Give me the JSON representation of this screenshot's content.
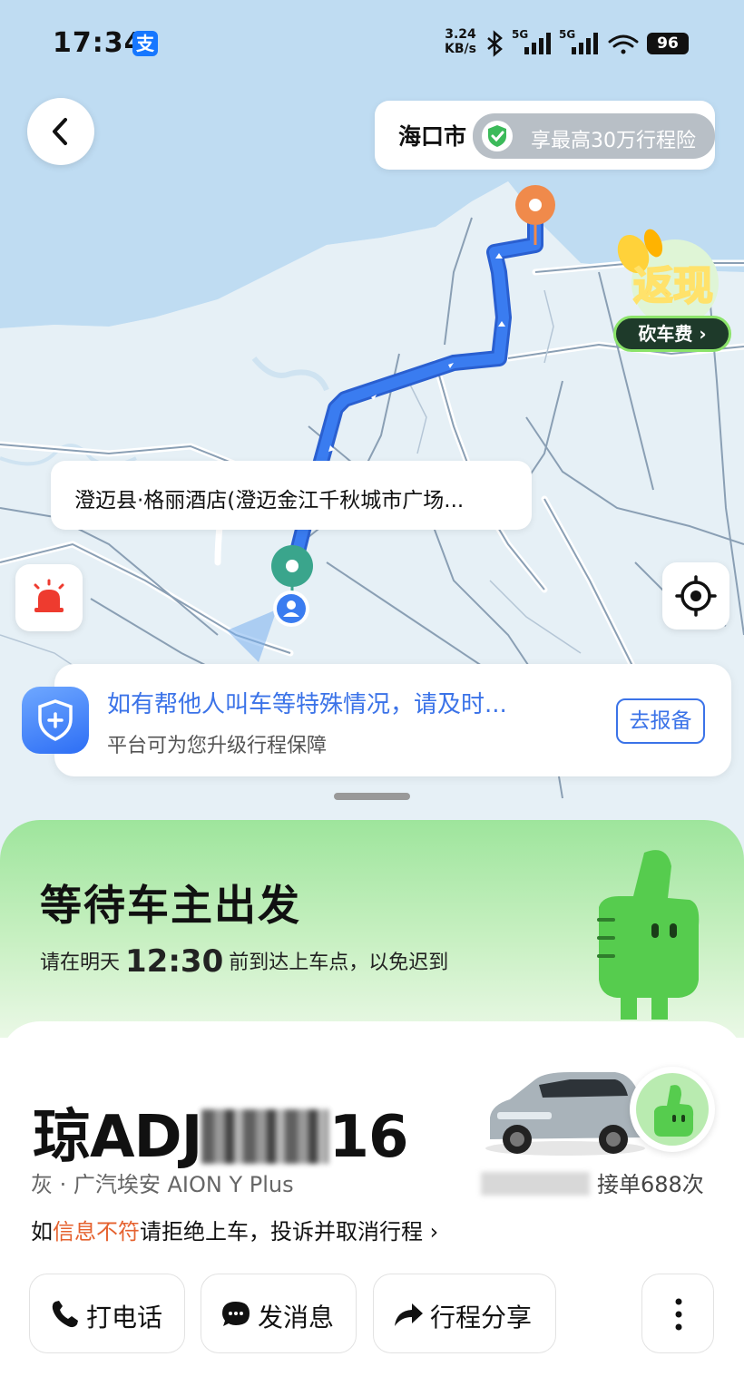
{
  "status_bar": {
    "time": "17:34",
    "alipay_glyph": "支",
    "speed_value": "3.24",
    "speed_unit": "KB/s",
    "net1": "5G",
    "net2": "5G",
    "battery": "96"
  },
  "map": {
    "city": "海口市",
    "insurance_text": "享最高30万行程险",
    "cashback_title": "返现",
    "cashback_sub": "砍车费 ›",
    "pickup_label": "澄迈县·格丽酒店(澄迈金江千秋城市广场...",
    "notice_title": "如有帮他人叫车等特殊情况，请及时...",
    "notice_sub": "平台可为您升级行程保障",
    "notice_button": "去报备"
  },
  "status_card": {
    "title": "等待车主出发",
    "line_prefix": "请在明天",
    "pickup_time": "12:30",
    "line_suffix": "前到达上车点，以免迟到"
  },
  "driver": {
    "plate_prefix": "琼ADJ",
    "plate_suffix": "16",
    "car_info": "灰 · 广汽埃安 AION Y Plus",
    "orders": "接单688次",
    "warn_prefix": "如",
    "warn_highlight": "信息不符",
    "warn_suffix": "请拒绝上车，投诉并取消行程 ›"
  },
  "actions": {
    "call": "打电话",
    "message": "发消息",
    "share": "行程分享",
    "more": "⋮"
  },
  "colors": {
    "route": "#3a7cf0",
    "accent_blue": "#3b73e8",
    "highlight_orange": "#e5622f",
    "status_green": "#9ee59c",
    "pickup_pin": "#3aa58c",
    "dest_pin": "#f08a4b"
  },
  "icons": [
    "back-icon",
    "shield-check-icon",
    "sos-alarm-icon",
    "locate-icon",
    "shield-plus-icon",
    "phone-icon",
    "chat-icon",
    "share-arrow-icon",
    "more-icon"
  ]
}
